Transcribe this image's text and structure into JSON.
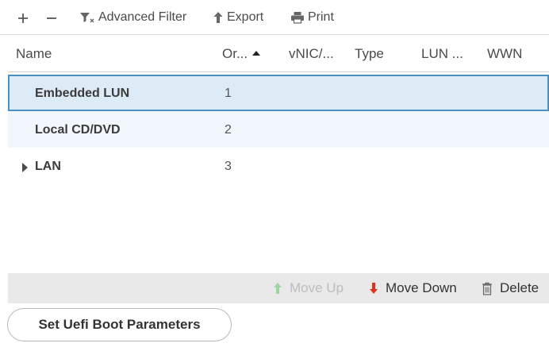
{
  "toolbar": {
    "add_icon": "plus-icon",
    "remove_icon": "minus-icon",
    "advanced_filter_label": "Advanced Filter",
    "export_label": "Export",
    "print_label": "Print"
  },
  "table": {
    "columns": [
      "Name",
      "Or...",
      "vNIC/...",
      "Type",
      "LUN ...",
      "WWN"
    ],
    "sort": {
      "column": "Or...",
      "direction": "ascending"
    },
    "rows": [
      {
        "name": "Embedded LUN",
        "order": "1",
        "selected": true
      },
      {
        "name": "Local CD/DVD",
        "order": "2"
      },
      {
        "name": "LAN",
        "order": "3",
        "expandable": true
      }
    ]
  },
  "actions": {
    "move_up_label": "Move Up",
    "move_down_label": "Move Down",
    "delete_label": "Delete"
  },
  "uefi_button_label": "Set Uefi Boot Parameters",
  "colors": {
    "selected_row_bg": "#dcebf6",
    "selected_row_border": "#4a90c4",
    "alt_row_bg": "#f1f7fc",
    "move_up_disabled": "#bdbdbd",
    "move_up_icon": "#9fd49f",
    "move_down_icon": "#e0301e"
  }
}
